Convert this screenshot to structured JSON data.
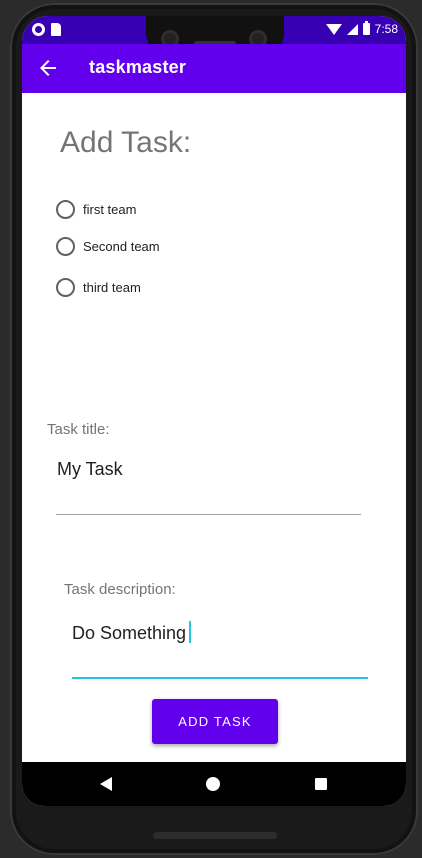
{
  "status_bar": {
    "time": "7:58",
    "icons": [
      "notification-dot-icon",
      "sd-card-icon",
      "wifi-icon",
      "signal-icon",
      "battery-icon"
    ]
  },
  "app_bar": {
    "title": "taskmaster",
    "back_icon": "arrow-left-icon"
  },
  "form": {
    "heading": "Add Task:",
    "teams": [
      {
        "label": "first team",
        "selected": false
      },
      {
        "label": "Second team",
        "selected": false
      },
      {
        "label": "third team",
        "selected": false
      }
    ],
    "title_label": "Task title:",
    "title_value": "My Task",
    "description_label": "Task description:",
    "description_value": "Do Something",
    "submit_label": "ADD TASK"
  },
  "nav_bar": {
    "icons": [
      "nav-back-icon",
      "nav-home-icon",
      "nav-recents-icon"
    ]
  },
  "colors": {
    "status_bar": "#3700b3",
    "primary": "#6200ee",
    "accent": "#26c6da"
  }
}
